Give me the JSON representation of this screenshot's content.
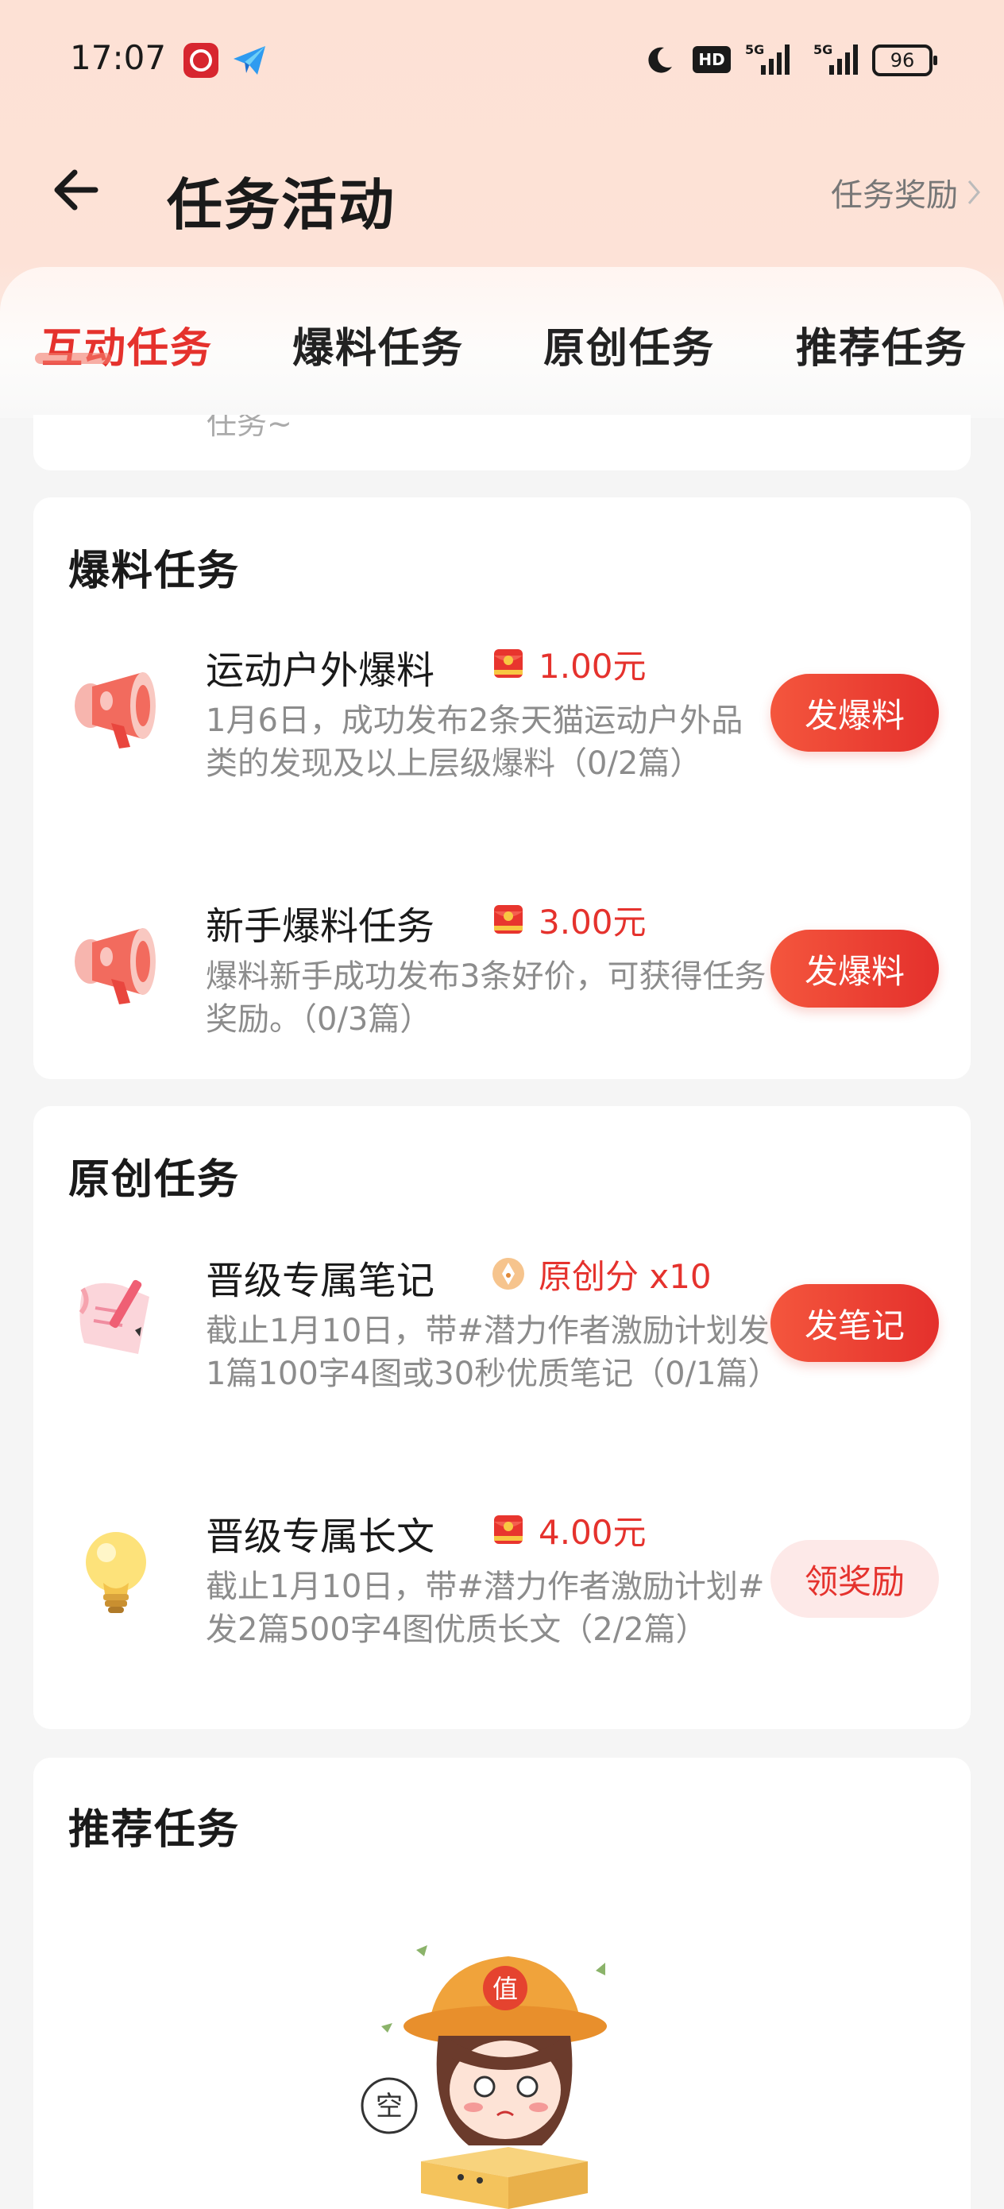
{
  "status_bar": {
    "time": "17:07",
    "hd_label": "HD",
    "signal_1_label": "5G",
    "signal_2_label": "5G",
    "battery_level": "96"
  },
  "header": {
    "title": "任务活动",
    "reward_link": "任务奖励"
  },
  "tabs": [
    {
      "label": "互动任务",
      "active": true
    },
    {
      "label": "爆料任务",
      "active": false
    },
    {
      "label": "原创任务",
      "active": false
    },
    {
      "label": "推荐任务",
      "active": false
    }
  ],
  "top_card": {
    "text": "任务~"
  },
  "baoliao_section": {
    "title": "爆料任务",
    "tasks": [
      {
        "icon": "megaphone-icon",
        "title": "运动户外爆料",
        "reward_icon": "red-packet-icon",
        "reward": "1.00元",
        "description": "1月6日，成功发布2条天猫运动户外品类的发现及以上层级爆料（0/2篇）",
        "button": "发爆料"
      },
      {
        "icon": "megaphone-icon",
        "title": "新手爆料任务",
        "reward_icon": "red-packet-icon",
        "reward": "3.00元",
        "description": "爆料新手成功发布3条好价，可获得任务奖励。（0/3篇）",
        "button": "发爆料"
      }
    ]
  },
  "original_section": {
    "title": "原创任务",
    "tasks": [
      {
        "icon": "note-paper-icon",
        "title": "晋级专属笔记",
        "reward_icon": "pen-nib-icon",
        "reward": "原创分 x10",
        "description": "截止1月10日，带#潜力作者激励计划发1篇100字4图或30秒优质笔记（0/1篇）",
        "button": "发笔记"
      },
      {
        "icon": "light-bulb-icon",
        "title": "晋级专属长文",
        "reward_icon": "red-packet-icon",
        "reward": "4.00元",
        "description": "截止1月10日，带#潜力作者激励计划#发2篇500字4图优质长文（2/2篇）",
        "button": "领奖励"
      }
    ]
  },
  "recommend_section": {
    "title": "推荐任务",
    "illustration_text": "值",
    "illustration_bubble": "空"
  },
  "colors": {
    "accent": "#e5322d",
    "header_bg": "#fde1d5",
    "claim_button_bg": "#fde9e8"
  }
}
